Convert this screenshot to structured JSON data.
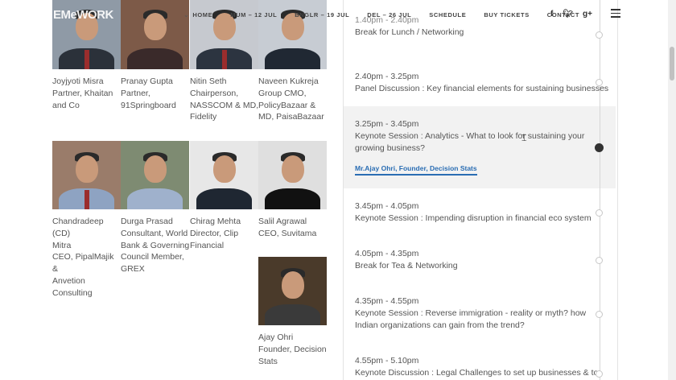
{
  "header": {
    "logo": "EMeWORK",
    "nav": [
      {
        "label": "HOME",
        "chevron": true
      },
      {
        "label": "MUM – 12 JUL"
      },
      {
        "label": "BNGLR – 19 JUL"
      },
      {
        "label": "DEL – 26 JUL"
      },
      {
        "label": "SCHEDULE"
      },
      {
        "label": "BUY TICKETS"
      },
      {
        "label": "CONTACT"
      }
    ],
    "social": [
      "f",
      "t",
      "g+"
    ]
  },
  "speakers": [
    {
      "lines": [
        "Joyjyoti Misra",
        "Partner, Khaitan",
        "and Co"
      ]
    },
    {
      "lines": [
        "Pranay Gupta",
        "Partner,",
        "91Springboard"
      ]
    },
    {
      "lines": [
        "Nitin Seth",
        "Chairperson,",
        "NASSCOM & MD,",
        "Fidelity"
      ]
    },
    {
      "lines": [
        "Naveen Kukreja",
        "Group CMO,",
        "PolicyBazaar &",
        "MD, PaisaBazaar"
      ]
    },
    {
      "lines": [
        "Chandradeep (CD)",
        "Mitra",
        "CEO, PipalMajik &",
        "Anvetion",
        "Consulting"
      ]
    },
    {
      "lines": [
        "Durga Prasad",
        "Consultant, World",
        "Bank & Governing",
        "Council Member,",
        "GREX"
      ]
    },
    {
      "lines": [
        "Chirag Mehta",
        "Director, Clip",
        "Financial"
      ]
    },
    {
      "lines": [
        "Salil Agrawal",
        "CEO, Suvitama"
      ]
    },
    {
      "lines": [
        "Ajay Ohri",
        "Founder, Decision",
        "Stats"
      ]
    }
  ],
  "schedule": [
    {
      "time": "1.40pm - 2.40pm",
      "title": "Break for Lunch / Networking"
    },
    {
      "time": "2.40pm - 3.25pm",
      "title": "Panel Discussion : Key financial elements for sustaining businesses"
    },
    {
      "time": "3.25pm - 3.45pm",
      "title": "Keynote Session : Analytics - What to look for sustaining your growing business?",
      "speaker": "Mr.Ajay Ohri, Founder, Decision Stats",
      "active": true
    },
    {
      "time": "3.45pm - 4.05pm",
      "title": "Keynote Session : Impending disruption in financial eco system"
    },
    {
      "time": "4.05pm - 4.35pm",
      "title": "Break for Tea & Networking"
    },
    {
      "time": "4.35pm - 4.55pm",
      "title": "Keynote Session : Reverse immigration - reality or myth? how Indian organizations can gain from the trend?"
    },
    {
      "time": "4.55pm - 5.10pm",
      "title": "Keynote Discussion : Legal Challenges to set up businesses & to grow"
    }
  ],
  "colors": {
    "link": "#2a6db3",
    "active_dot": "#333333"
  }
}
